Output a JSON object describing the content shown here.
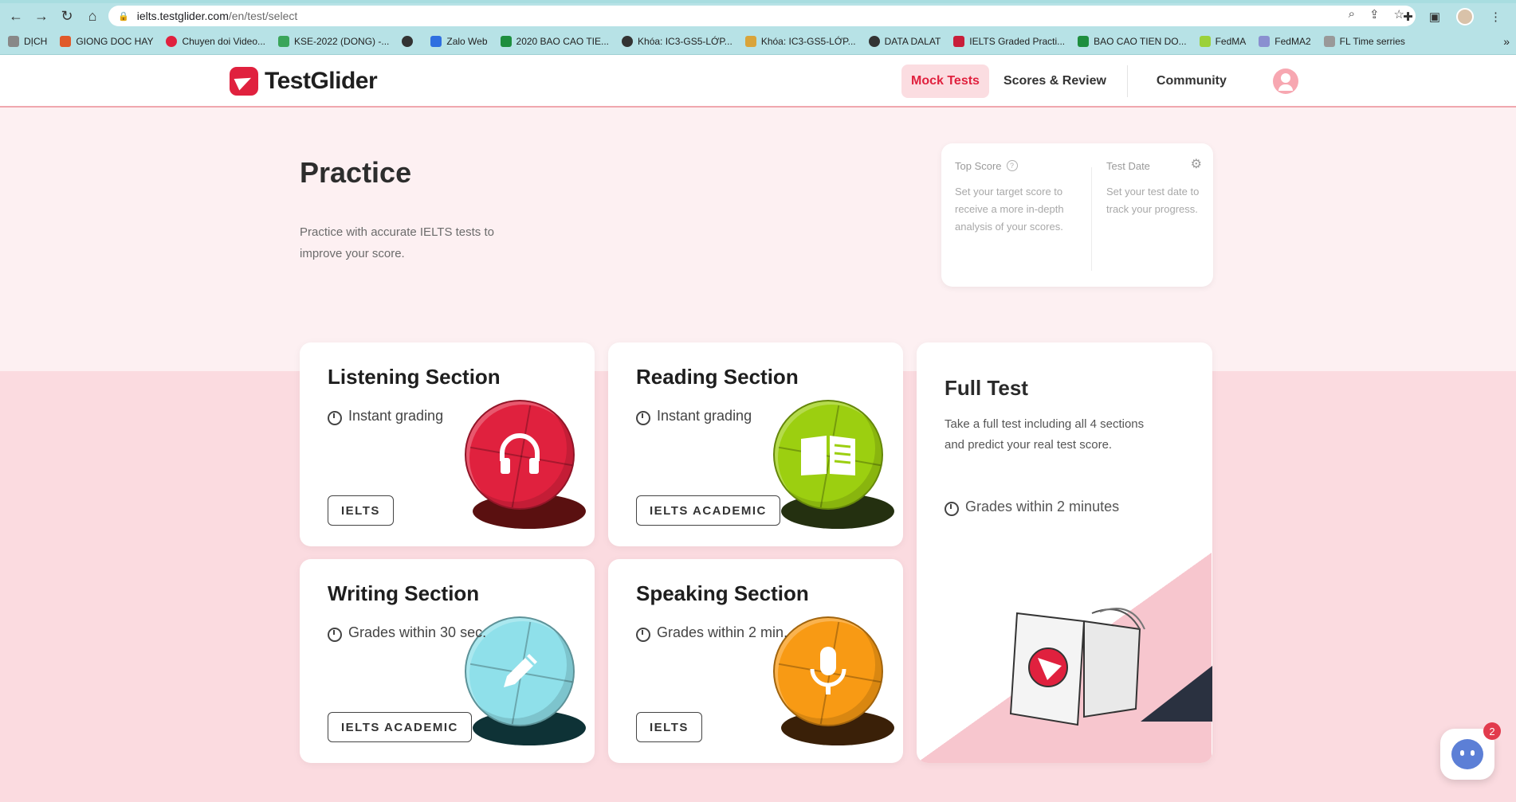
{
  "browser": {
    "url_host": "ielts.testglider.com",
    "url_path": "/en/test/select",
    "bookmarks": [
      {
        "label": "DỊCH",
        "color": "#888888"
      },
      {
        "label": "GIONG DOC HAY",
        "color": "#e05a2a"
      },
      {
        "label": "Chuyen doi Video...",
        "color": "#e0213e"
      },
      {
        "label": "KSE-2022 (DONG) -...",
        "color": "#3aa55a"
      },
      {
        "label": "",
        "color": "#333333"
      },
      {
        "label": "Zalo Web",
        "color": "#2f6fe0"
      },
      {
        "label": "2020 BAO CAO TIE...",
        "color": "#1e8e3e"
      },
      {
        "label": "Khóa: IC3-GS5-LỚP...",
        "color": "#333333"
      },
      {
        "label": "Khóa: IC3-GS5-LỚP...",
        "color": "#d9a43a"
      },
      {
        "label": "DATA DALAT",
        "color": "#333333"
      },
      {
        "label": "IELTS Graded Practi...",
        "color": "#c81e3a"
      },
      {
        "label": "BAO CAO TIEN DO...",
        "color": "#1e8e3e"
      },
      {
        "label": "FedMA",
        "color": "#9bd13a"
      },
      {
        "label": "FedMA2",
        "color": "#8a8fd0"
      },
      {
        "label": "FL Time serries",
        "color": "#999999"
      }
    ]
  },
  "header": {
    "logo_text": "TestGlider",
    "nav": {
      "mock_tests": "Mock Tests",
      "scores_review": "Scores & Review",
      "community": "Community"
    }
  },
  "hero": {
    "title": "Practice",
    "subtitle": "Practice with accurate IELTS tests to improve your score."
  },
  "goal_card": {
    "top_score_label": "Top Score",
    "top_score_text": "Set your target score to receive a more in-depth analysis of your scores.",
    "test_date_label": "Test Date",
    "test_date_text": "Set your test date to track your progress."
  },
  "sections": {
    "listening": {
      "title": "Listening Section",
      "meta": "Instant grading",
      "tag": "IELTS",
      "color": "#e0213e"
    },
    "reading": {
      "title": "Reading Section",
      "meta": "Instant grading",
      "tag": "IELTS ACADEMIC",
      "color": "#9ccf10"
    },
    "writing": {
      "title": "Writing Section",
      "meta": "Grades within 30 sec.",
      "tag": "IELTS ACADEMIC",
      "color": "#8fe0ea"
    },
    "speaking": {
      "title": "Speaking Section",
      "meta": "Grades within 2 min.",
      "tag": "IELTS",
      "color": "#f89a14"
    }
  },
  "full_test": {
    "title": "Full Test",
    "description": "Take a full test including all 4 sections and predict your real test score.",
    "meta": "Grades within 2 minutes"
  },
  "chat": {
    "badge": "2"
  }
}
